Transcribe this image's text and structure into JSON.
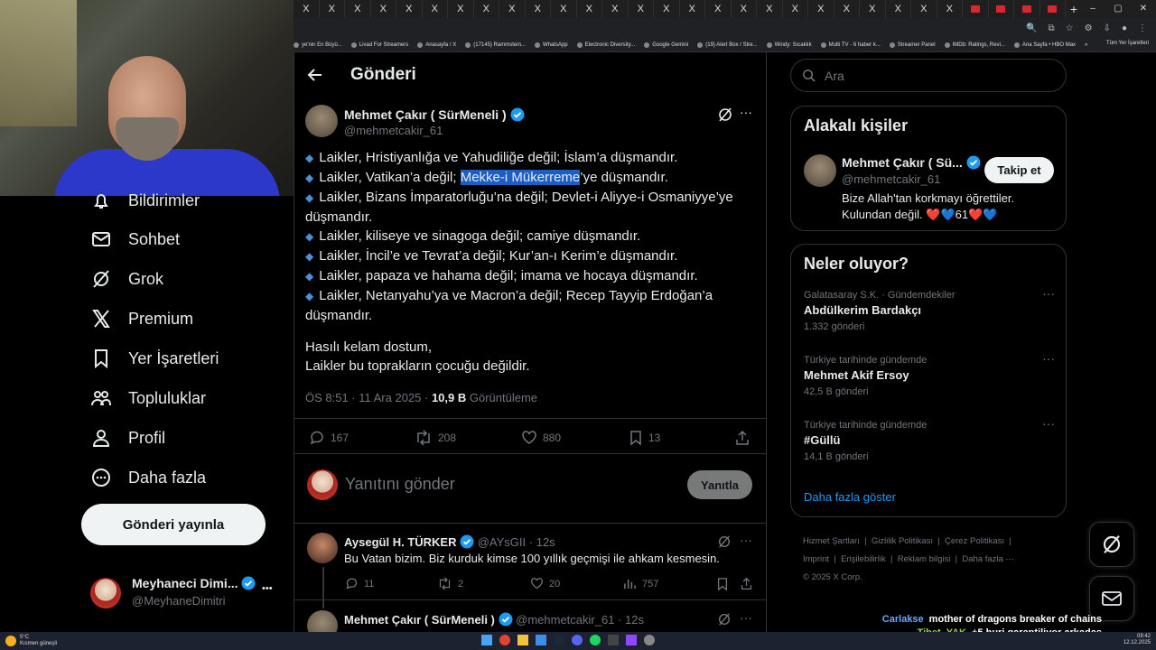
{
  "browser": {
    "tab_close_glyph": "X",
    "new_tab": "+",
    "window_controls": [
      "–",
      "▢",
      "✕"
    ],
    "bookmarks": [
      "ye'nin En Büyü...",
      "Livad For Streamers",
      "Anasayfa / X",
      "(17145) Rammstein...",
      "WhatsApp",
      "Electronic Diversity...",
      "Google Gemini",
      "(19) Alert Box / Stre...",
      "Windy: Sıcaklık",
      "Multi TV - 6 haber k...",
      "Streamer Panel",
      "IMDb: Ratings, Revi...",
      "Ana Sayfa • HBO Max"
    ],
    "bookmarks_more": "»",
    "all_bookmarks": "Tüm Yer İşaretleri"
  },
  "nav": {
    "items": [
      {
        "label": "Bildirimler",
        "icon": "bell-icon"
      },
      {
        "label": "Sohbet",
        "icon": "mail-icon"
      },
      {
        "label": "Grok",
        "icon": "grok-icon"
      },
      {
        "label": "Premium",
        "icon": "x-logo-icon"
      },
      {
        "label": "Yer İşaretleri",
        "icon": "bookmark-icon"
      },
      {
        "label": "Topluluklar",
        "icon": "people-icon"
      },
      {
        "label": "Profil",
        "icon": "person-icon"
      },
      {
        "label": "Daha fazla",
        "icon": "more-circle-icon"
      }
    ],
    "post_button": "Gönderi yayınla",
    "account": {
      "name": "Meyhaneci Dimi...",
      "handle": "@MeyhaneDimitri",
      "more": "•••"
    }
  },
  "header": {
    "title": "Gönderi"
  },
  "tweet": {
    "author": "Mehmet Çakır ( SürMeneli )",
    "handle": "@mehmetcakir_61",
    "lines": [
      {
        "pre": "Laikler, Hristiyanlığa ve Yahudiliğe değil; İslam’a düşmandır.",
        "hl": "",
        "post": ""
      },
      {
        "pre": "Laikler, Vatikan’a değil; ",
        "hl": "Mekke-i Mükerreme",
        "post": "’ye düşmandır."
      },
      {
        "pre": "Laikler, Bizans İmparatorluğu’na değil; Devlet-i Aliyye-i Osmaniyye’ye düşmandır.",
        "hl": "",
        "post": ""
      },
      {
        "pre": "Laikler, kiliseye ve sinagoga değil; camiye düşmandır.",
        "hl": "",
        "post": ""
      },
      {
        "pre": "Laikler, İncil’e ve Tevrat’a değil; Kur’an-ı Kerim’e düşmandır.",
        "hl": "",
        "post": ""
      },
      {
        "pre": "Laikler, papaza ve hahama değil; imama ve hocaya düşmandır.",
        "hl": "",
        "post": ""
      },
      {
        "pre": "Laikler, Netanyahu’ya ve Macron’a değil; Recep Tayyip Erdoğan’a düşmandır.",
        "hl": "",
        "post": ""
      }
    ],
    "outro1": "Hasılı kelam dostum,",
    "outro2": "Laikler bu toprakların çocuğu değildir.",
    "time": "ÖS 8:51 · 11 Ara 2025 · ",
    "views_count": "10,9 B",
    "views_label": " Görüntüleme",
    "replies": "167",
    "retweets": "208",
    "likes": "880",
    "bookmarks": "13"
  },
  "reply_box": {
    "placeholder": "Yanıtını gönder",
    "button": "Yanıtla"
  },
  "replies": [
    {
      "author": "Aysegül H. TÜRKER",
      "handle": "@AYsGII",
      "time": "· 12s",
      "text": "Bu Vatan bizim. Biz kurduk kimse 100 yıllık geçmişi ile ahkam kesmesin.",
      "replies": "11",
      "retweets": "2",
      "likes": "20",
      "views": "757"
    },
    {
      "author": "Mehmet Çakır ( SürMeneli )",
      "handle": "@mehmetcakir_61",
      "time": "· 12s"
    }
  ],
  "search": {
    "placeholder": "Ara"
  },
  "related": {
    "title": "Alakalı kişiler",
    "name": "Mehmet Çakır ( Sü...",
    "handle": "@mehmetcakir_61",
    "follow": "Takip et",
    "bio1": "Bize Allah'tan korkmayı öğrettiler.",
    "bio2": "Kulundan değil.",
    "bio_hearts": "❤️💙61❤️💙"
  },
  "trends": {
    "title": "Neler oluyor?",
    "items": [
      {
        "cat": "Galatasaray S.K. · Gündemdekiler",
        "name": "Abdülkerim Bardakçı",
        "count": "1.332 gönderi"
      },
      {
        "cat": "Türkiye tarihinde gündemde",
        "name": "Mehmet Akif Ersoy",
        "count": "42,5 B gönderi"
      },
      {
        "cat": "Türkiye tarihinde gündemde",
        "name": "#Güllü",
        "count": "14,1 B gönderi"
      }
    ],
    "more": "Daha fazla göster"
  },
  "footer": {
    "links": [
      "Hizmet Şartları",
      "Gizlilik Politikası",
      "Çerez Politikası",
      "Imprint",
      "Erişilebilirlik",
      "Reklam bilgisi",
      "Daha fazla ···"
    ],
    "copyright": "© 2025 X Corp."
  },
  "chat": [
    {
      "user": "Carlakse",
      "msg": "mother of dragons breaker of chains",
      "color": "#6aa8ff"
    },
    {
      "user": "Tibet_YAK",
      "msg": "+5 huri garantiliyor arkadaş",
      "color": "#8fd14f"
    }
  ],
  "taskbar": {
    "weather_temp": "5°C",
    "weather_text": "Kısmen güneşli",
    "time": "09:42",
    "date": "12.12.2025"
  }
}
